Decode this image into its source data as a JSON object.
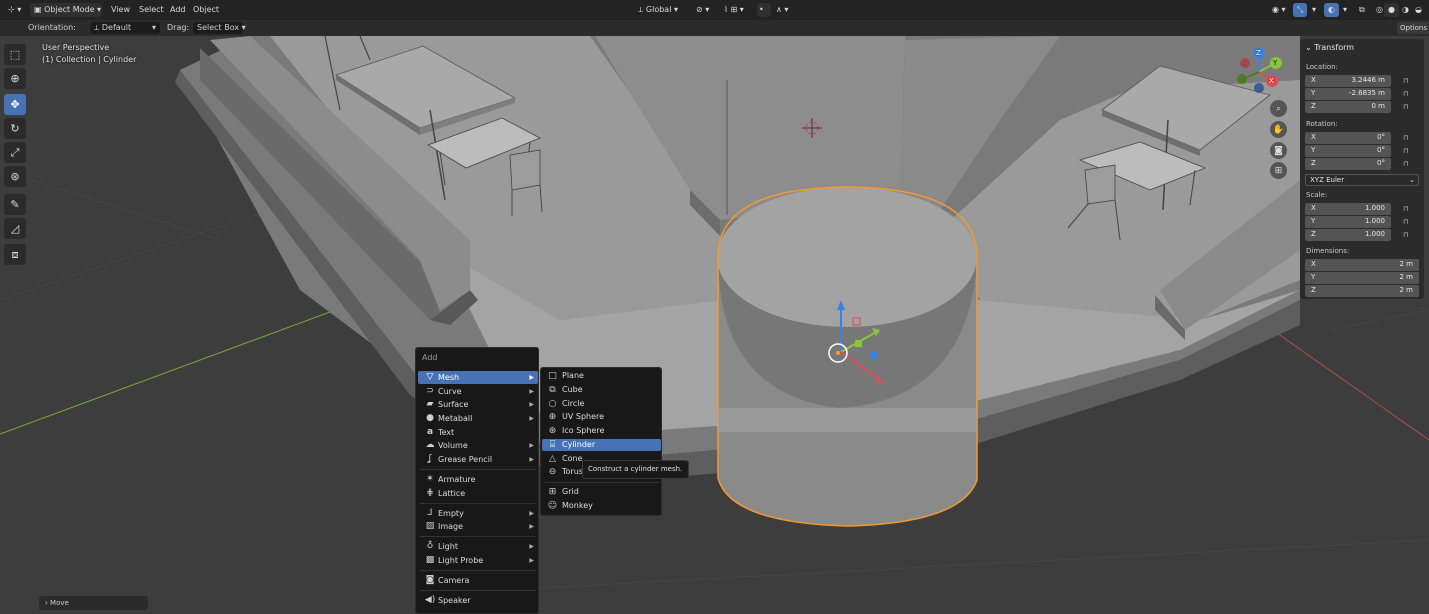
{
  "header": {
    "editor_icon": "3d-viewport-icon",
    "mode": "Object Mode",
    "menus": [
      "View",
      "Select",
      "Add",
      "Object"
    ],
    "transform_orientation": "Global",
    "pivot_icon": "pivot-icon",
    "snap_icon": "snap-icon",
    "proportional_icon": "proportional-editing-icon"
  },
  "toolsettings": {
    "orientation_label": "Orientation:",
    "orientation_value": "Default",
    "drag_label": "Drag:",
    "drag_value": "Select Box",
    "options_label": "Options"
  },
  "viewport": {
    "view_name": "User Perspective",
    "collection_info": "(1) Collection | Cylinder"
  },
  "toolbar": {
    "tools": [
      "select-box-icon",
      "cursor-icon",
      "move-icon",
      "rotate-icon",
      "scale-icon",
      "transform-icon",
      "annotate-icon",
      "measure-icon",
      "add-cube-icon"
    ],
    "active_index": 2
  },
  "nav_gizmo": {
    "axes": [
      "X",
      "Y",
      "Z"
    ],
    "colors": {
      "x": "#e24b57",
      "y": "#8ac53b",
      "z": "#3b83e1"
    },
    "buttons": [
      "zoom-icon",
      "hand-pan-icon",
      "camera-icon",
      "grid-icon"
    ]
  },
  "transform_panel": {
    "title": "Transform",
    "location_label": "Location:",
    "location": [
      {
        "axis": "X",
        "value": "3.2446 m"
      },
      {
        "axis": "Y",
        "value": "-2.6835 m"
      },
      {
        "axis": "Z",
        "value": "0 m"
      }
    ],
    "rotation_label": "Rotation:",
    "rotation": [
      {
        "axis": "X",
        "value": "0°"
      },
      {
        "axis": "Y",
        "value": "0°"
      },
      {
        "axis": "Z",
        "value": "0°"
      }
    ],
    "rotation_mode": "XYZ Euler",
    "scale_label": "Scale:",
    "scale": [
      {
        "axis": "X",
        "value": "1.000"
      },
      {
        "axis": "Y",
        "value": "1.000"
      },
      {
        "axis": "Z",
        "value": "1.000"
      }
    ],
    "dimensions_label": "Dimensions:",
    "dimensions": [
      {
        "axis": "X",
        "value": "2 m"
      },
      {
        "axis": "Y",
        "value": "2 m"
      },
      {
        "axis": "Z",
        "value": "2 m"
      }
    ]
  },
  "add_menu": {
    "title": "Add",
    "items": [
      {
        "label": "Mesh",
        "icon": "mesh-icon",
        "submenu": true,
        "highlighted": true
      },
      {
        "label": "Curve",
        "icon": "curve-icon",
        "submenu": true
      },
      {
        "label": "Surface",
        "icon": "surface-icon",
        "submenu": true
      },
      {
        "label": "Metaball",
        "icon": "metaball-icon",
        "submenu": true
      },
      {
        "label": "Text",
        "icon": "text-icon",
        "submenu": false
      },
      {
        "label": "Volume",
        "icon": "volume-icon",
        "submenu": true
      },
      {
        "label": "Grease Pencil",
        "icon": "grease-pencil-icon",
        "submenu": true
      },
      {
        "label": "Armature",
        "icon": "armature-icon",
        "submenu": false
      },
      {
        "label": "Lattice",
        "icon": "lattice-icon",
        "submenu": false
      },
      {
        "label": "Empty",
        "icon": "empty-icon",
        "submenu": true
      },
      {
        "label": "Image",
        "icon": "image-icon",
        "submenu": true
      },
      {
        "label": "Light",
        "icon": "light-icon",
        "submenu": true
      },
      {
        "label": "Light Probe",
        "icon": "light-probe-icon",
        "submenu": true
      },
      {
        "label": "Camera",
        "icon": "camera-icon",
        "submenu": false
      },
      {
        "label": "Speaker",
        "icon": "speaker-icon",
        "submenu": false
      }
    ]
  },
  "mesh_submenu": {
    "items": [
      {
        "label": "Plane",
        "icon": "plane-icon"
      },
      {
        "label": "Cube",
        "icon": "cube-icon"
      },
      {
        "label": "Circle",
        "icon": "circle-icon"
      },
      {
        "label": "UV Sphere",
        "icon": "uv-sphere-icon"
      },
      {
        "label": "Ico Sphere",
        "icon": "ico-sphere-icon"
      },
      {
        "label": "Cylinder",
        "icon": "cylinder-icon",
        "highlighted": true
      },
      {
        "label": "Cone",
        "icon": "cone-icon"
      },
      {
        "label": "Torus",
        "icon": "torus-icon"
      },
      {
        "label": "Grid",
        "icon": "grid-icon"
      },
      {
        "label": "Monkey",
        "icon": "monkey-icon"
      }
    ]
  },
  "tooltip": "Construct a cylinder mesh.",
  "last_operator": "Move",
  "colors": {
    "accent": "#4772b3",
    "selection_outline": "#f39a2e",
    "header_bg": "#232323",
    "menu_bg": "#181818"
  }
}
